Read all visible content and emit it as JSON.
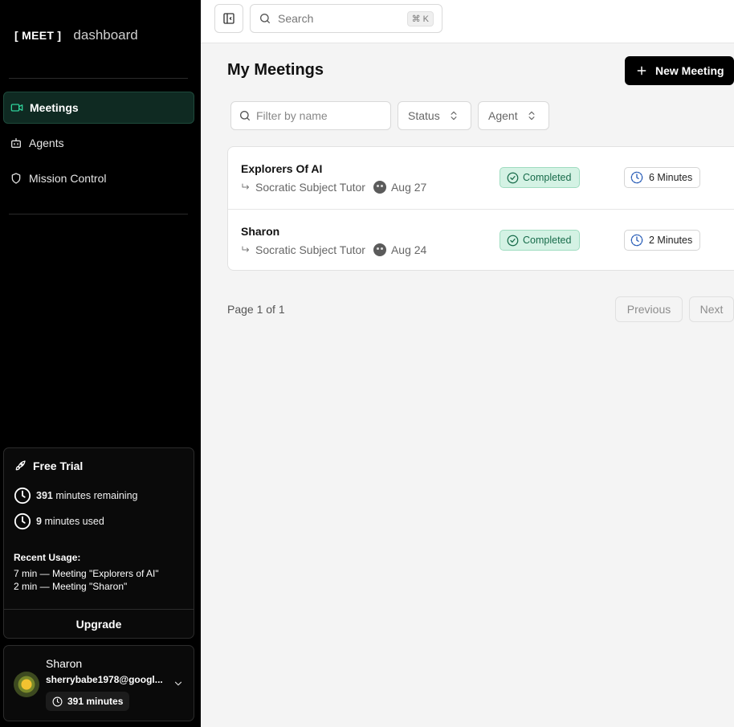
{
  "sidebar": {
    "brand_logo": "[ MEET ]",
    "brand_sub": "dashboard",
    "nav": [
      {
        "label": "Meetings",
        "icon": "video-icon",
        "active": true
      },
      {
        "label": "Agents",
        "icon": "bot-icon",
        "active": false
      },
      {
        "label": "Mission Control",
        "icon": "shield-icon",
        "active": false
      }
    ],
    "trial": {
      "title": "Free Trial",
      "remaining_value": "391",
      "remaining_label": "minutes remaining",
      "used_value": "9",
      "used_label": "minutes used",
      "recent_title": "Recent Usage:",
      "recent": [
        "7 min — Meeting \"Explorers of AI\"",
        "2 min — Meeting \"Sharon\""
      ],
      "upgrade_label": "Upgrade"
    },
    "user": {
      "name": "Sharon",
      "email": "sherrybabe1978@googl...",
      "minutes": "391 minutes"
    }
  },
  "topbar": {
    "search_placeholder": "Search",
    "shortcut_symbol": "⌘",
    "shortcut_key": "K"
  },
  "main": {
    "title": "My Meetings",
    "new_button": "New Meeting",
    "filter_placeholder": "Filter by name",
    "status_dropdown": "Status",
    "agent_dropdown": "Agent",
    "meetings": [
      {
        "name": "Explorers Of AI",
        "agent": "Socratic Subject Tutor",
        "date": "Aug 27",
        "status": "Completed",
        "duration": "6 Minutes"
      },
      {
        "name": "Sharon",
        "agent": "Socratic Subject Tutor",
        "date": "Aug 24",
        "status": "Completed",
        "duration": "2 Minutes"
      }
    ],
    "page_info": "Page 1 of 1",
    "previous_label": "Previous",
    "next_label": "Next"
  },
  "colors": {
    "sidebar_bg": "#000000",
    "active_nav_bg": "#0f2a22",
    "status_completed_bg": "#d4f2e4",
    "status_completed_text": "#176b4a",
    "duration_icon": "#2b5fb8"
  }
}
